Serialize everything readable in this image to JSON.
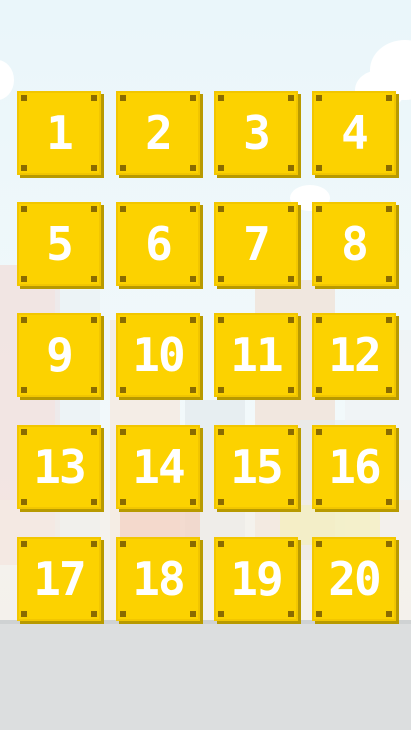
{
  "levels": [
    {
      "label": "1"
    },
    {
      "label": "2"
    },
    {
      "label": "3"
    },
    {
      "label": "4"
    },
    {
      "label": "5"
    },
    {
      "label": "6"
    },
    {
      "label": "7"
    },
    {
      "label": "8"
    },
    {
      "label": "9"
    },
    {
      "label": "10"
    },
    {
      "label": "11"
    },
    {
      "label": "12"
    },
    {
      "label": "13"
    },
    {
      "label": "14"
    },
    {
      "label": "15"
    },
    {
      "label": "16"
    },
    {
      "label": "17"
    },
    {
      "label": "18"
    },
    {
      "label": "19"
    },
    {
      "label": "20"
    }
  ],
  "colors": {
    "tile": "#fcd200",
    "tile_shadow": "#b89a00",
    "rivet": "#8a6b00",
    "digit": "#ffffff",
    "ground": "#dcdedf",
    "sky": "#eaf6fa"
  }
}
